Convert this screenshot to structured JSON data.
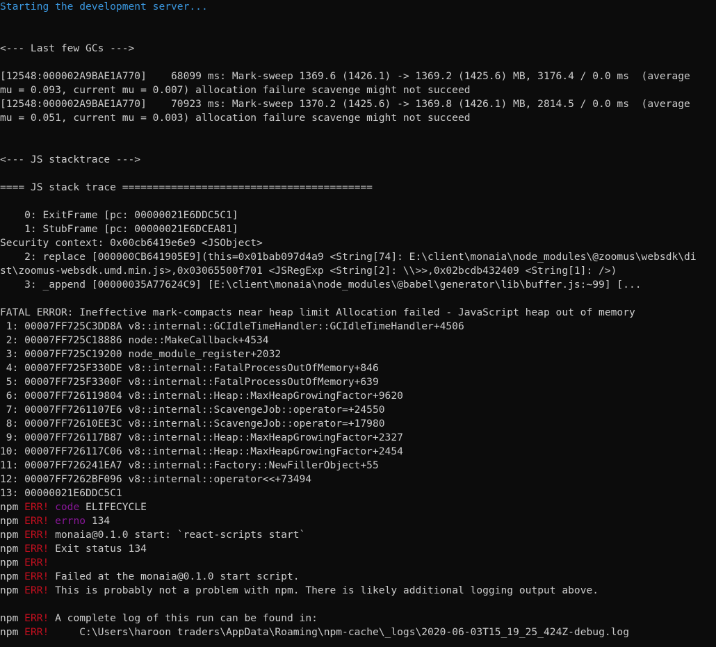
{
  "window": {
    "background": "#0c0c0c"
  },
  "colors": {
    "default": "#cccccc",
    "blue": "#3a96dd",
    "red": "#c50f1f",
    "magenta": "#881798"
  },
  "lines": [
    {
      "row": 0,
      "segments": [
        {
          "text": "Starting the development server...",
          "color": "blue"
        }
      ]
    },
    {
      "row": 3,
      "segments": [
        {
          "text": "<--- Last few GCs --->",
          "color": "default"
        }
      ]
    },
    {
      "row": 5,
      "segments": [
        {
          "text": "[12548:000002A9BAE1A770]    68099 ms: Mark-sweep 1369.6 (1426.1) -> 1369.2 (1425.6) MB, 3176.4 / 0.0 ms  (average",
          "color": "default"
        }
      ]
    },
    {
      "row": 6,
      "segments": [
        {
          "text": "mu = 0.093, current mu = 0.007) allocation failure scavenge might not succeed",
          "color": "default"
        }
      ]
    },
    {
      "row": 7,
      "segments": [
        {
          "text": "[12548:000002A9BAE1A770]    70923 ms: Mark-sweep 1370.2 (1425.6) -> 1369.8 (1426.1) MB, 2814.5 / 0.0 ms  (average",
          "color": "default"
        }
      ]
    },
    {
      "row": 8,
      "segments": [
        {
          "text": "mu = 0.051, current mu = 0.003) allocation failure scavenge might not succeed",
          "color": "default"
        }
      ]
    },
    {
      "row": 11,
      "segments": [
        {
          "text": "<--- JS stacktrace --->",
          "color": "default"
        }
      ]
    },
    {
      "row": 13,
      "segments": [
        {
          "text": "==== JS stack trace =========================================",
          "color": "default"
        }
      ]
    },
    {
      "row": 15,
      "segments": [
        {
          "text": "    0: ExitFrame [pc: 00000021E6DDC5C1]",
          "color": "default"
        }
      ]
    },
    {
      "row": 16,
      "segments": [
        {
          "text": "    1: StubFrame [pc: 00000021E6DCEA81]",
          "color": "default"
        }
      ]
    },
    {
      "row": 17,
      "segments": [
        {
          "text": "Security context: 0x00cb6419e6e9 <JSObject>",
          "color": "default"
        }
      ]
    },
    {
      "row": 18,
      "segments": [
        {
          "text": "    2: replace [000000CB641905E9](this=0x01bab097d4a9 <String[74]: E:\\client\\monaia\\node_modules\\@zoomus\\websdk\\di",
          "color": "default"
        }
      ]
    },
    {
      "row": 19,
      "segments": [
        {
          "text": "st\\zoomus-websdk.umd.min.js>,0x03065500f701 <JSRegExp <String[2]: \\\\>>,0x02bcdb432409 <String[1]: />)",
          "color": "default"
        }
      ]
    },
    {
      "row": 20,
      "segments": [
        {
          "text": "    3: _append [00000035A77624C9] [E:\\client\\monaia\\node_modules\\@babel\\generator\\lib\\buffer.js:~99] [...",
          "color": "default"
        }
      ]
    },
    {
      "row": 22,
      "segments": [
        {
          "text": "FATAL ERROR: Ineffective mark-compacts near heap limit Allocation failed - JavaScript heap out of memory",
          "color": "default"
        }
      ]
    },
    {
      "row": 23,
      "segments": [
        {
          "text": " 1: 00007FF725C3DD8A v8::internal::GCIdleTimeHandler::GCIdleTimeHandler+4506",
          "color": "default"
        }
      ]
    },
    {
      "row": 24,
      "segments": [
        {
          "text": " 2: 00007FF725C18886 node::MakeCallback+4534",
          "color": "default"
        }
      ]
    },
    {
      "row": 25,
      "segments": [
        {
          "text": " 3: 00007FF725C19200 node_module_register+2032",
          "color": "default"
        }
      ]
    },
    {
      "row": 26,
      "segments": [
        {
          "text": " 4: 00007FF725F330DE v8::internal::FatalProcessOutOfMemory+846",
          "color": "default"
        }
      ]
    },
    {
      "row": 27,
      "segments": [
        {
          "text": " 5: 00007FF725F3300F v8::internal::FatalProcessOutOfMemory+639",
          "color": "default"
        }
      ]
    },
    {
      "row": 28,
      "segments": [
        {
          "text": " 6: 00007FF726119804 v8::internal::Heap::MaxHeapGrowingFactor+9620",
          "color": "default"
        }
      ]
    },
    {
      "row": 29,
      "segments": [
        {
          "text": " 7: 00007FF7261107E6 v8::internal::ScavengeJob::operator=+24550",
          "color": "default"
        }
      ]
    },
    {
      "row": 30,
      "segments": [
        {
          "text": " 8: 00007FF72610EE3C v8::internal::ScavengeJob::operator=+17980",
          "color": "default"
        }
      ]
    },
    {
      "row": 31,
      "segments": [
        {
          "text": " 9: 00007FF726117B87 v8::internal::Heap::MaxHeapGrowingFactor+2327",
          "color": "default"
        }
      ]
    },
    {
      "row": 32,
      "segments": [
        {
          "text": "10: 00007FF726117C06 v8::internal::Heap::MaxHeapGrowingFactor+2454",
          "color": "default"
        }
      ]
    },
    {
      "row": 33,
      "segments": [
        {
          "text": "11: 00007FF726241EA7 v8::internal::Factory::NewFillerObject+55",
          "color": "default"
        }
      ]
    },
    {
      "row": 34,
      "segments": [
        {
          "text": "12: 00007FF7262BF096 v8::internal::operator<<+73494",
          "color": "default"
        }
      ]
    },
    {
      "row": 35,
      "segments": [
        {
          "text": "13: 00000021E6DDC5C1",
          "color": "default"
        }
      ]
    },
    {
      "row": 36,
      "segments": [
        {
          "text": "npm ",
          "color": "default"
        },
        {
          "text": "ERR!",
          "color": "red"
        },
        {
          "text": " ",
          "color": "default"
        },
        {
          "text": "code",
          "color": "magenta"
        },
        {
          "text": " ELIFECYCLE",
          "color": "default"
        }
      ]
    },
    {
      "row": 37,
      "segments": [
        {
          "text": "npm ",
          "color": "default"
        },
        {
          "text": "ERR!",
          "color": "red"
        },
        {
          "text": " ",
          "color": "default"
        },
        {
          "text": "errno",
          "color": "magenta"
        },
        {
          "text": " 134",
          "color": "default"
        }
      ]
    },
    {
      "row": 38,
      "segments": [
        {
          "text": "npm ",
          "color": "default"
        },
        {
          "text": "ERR!",
          "color": "red"
        },
        {
          "text": " monaia@0.1.0 start: `react-scripts start`",
          "color": "default"
        }
      ]
    },
    {
      "row": 39,
      "segments": [
        {
          "text": "npm ",
          "color": "default"
        },
        {
          "text": "ERR!",
          "color": "red"
        },
        {
          "text": " Exit status 134",
          "color": "default"
        }
      ]
    },
    {
      "row": 40,
      "segments": [
        {
          "text": "npm ",
          "color": "default"
        },
        {
          "text": "ERR!",
          "color": "red"
        }
      ]
    },
    {
      "row": 41,
      "segments": [
        {
          "text": "npm ",
          "color": "default"
        },
        {
          "text": "ERR!",
          "color": "red"
        },
        {
          "text": " Failed at the monaia@0.1.0 start script.",
          "color": "default"
        }
      ]
    },
    {
      "row": 42,
      "segments": [
        {
          "text": "npm ",
          "color": "default"
        },
        {
          "text": "ERR!",
          "color": "red"
        },
        {
          "text": " This is probably not a problem with npm. There is likely additional logging output above.",
          "color": "default"
        }
      ]
    },
    {
      "row": 44,
      "segments": [
        {
          "text": "npm ",
          "color": "default"
        },
        {
          "text": "ERR!",
          "color": "red"
        },
        {
          "text": " A complete log of this run can be found in:",
          "color": "default"
        }
      ]
    },
    {
      "row": 45,
      "segments": [
        {
          "text": "npm ",
          "color": "default"
        },
        {
          "text": "ERR!",
          "color": "red"
        },
        {
          "text": "     C:\\Users\\haroon traders\\AppData\\Roaming\\npm-cache\\_logs\\2020-06-03T15_19_25_424Z-debug.log",
          "color": "default"
        }
      ]
    }
  ]
}
